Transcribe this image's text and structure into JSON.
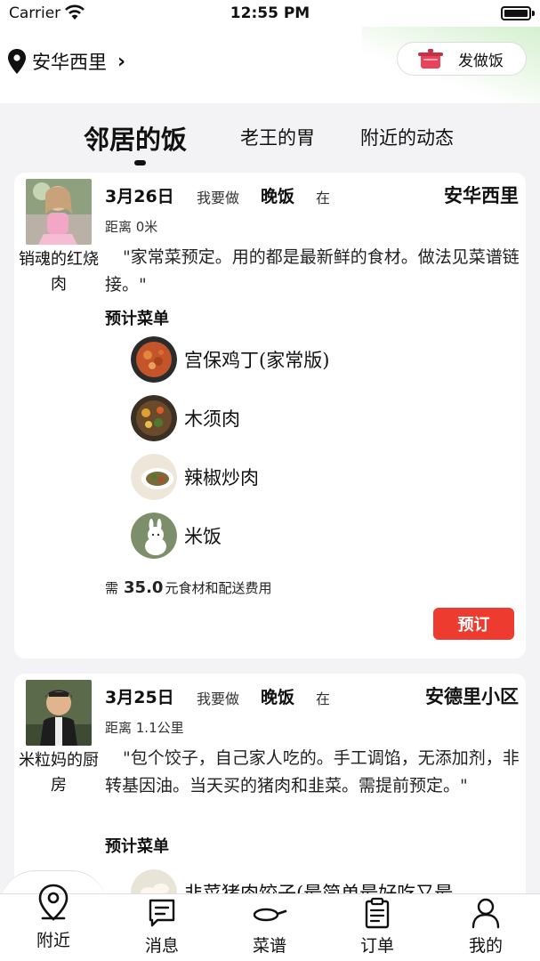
{
  "status_bar": {
    "carrier": "Carrier",
    "time": "12:55 PM"
  },
  "header": {
    "location": "安华西里",
    "cook_button": "发做饭"
  },
  "tabs": [
    {
      "label": "邻居的饭",
      "active": true
    },
    {
      "label": "老王的胃",
      "active": false
    },
    {
      "label": "附近的动态",
      "active": false
    }
  ],
  "posts": [
    {
      "cook_name": "销魂的红烧肉",
      "date": "3月26日",
      "i_want": "我要做",
      "meal": "晚饭",
      "at": "在",
      "place": "安华西里",
      "distance": "距离 0米",
      "description": "\"家常菜预定。用的都是最新鲜的食材。做法见菜谱链接。\"",
      "menu_title": "预计菜单",
      "dishes": [
        "宫保鸡丁(家常版)",
        "木须肉",
        "辣椒炒肉",
        "米饭"
      ],
      "price_prefix": "需",
      "price": "35.0",
      "price_suffix": "元食材和配送费用",
      "order_button": "预订"
    },
    {
      "cook_name": "米粒妈的厨房",
      "date": "3月25日",
      "i_want": "我要做",
      "meal": "晚饭",
      "at": "在",
      "place": "安德里小区",
      "distance": "距离 1.1公里",
      "description": "\"包个饺子，自己家人吃的。手工调馅，无添加剂，非转基因油。当天买的猪肉和韭菜。需提前预定。\"",
      "menu_title": "预计菜单",
      "dishes": [
        "韭菜猪肉饺子(最简单最好吃又最"
      ]
    }
  ],
  "tab_bar": [
    {
      "label": "附近",
      "icon": "location-pin-icon",
      "active": true
    },
    {
      "label": "消息",
      "icon": "message-icon"
    },
    {
      "label": "菜谱",
      "icon": "frying-pan-icon"
    },
    {
      "label": "订单",
      "icon": "clipboard-icon"
    },
    {
      "label": "我的",
      "icon": "person-icon"
    }
  ],
  "colors": {
    "accent_red": "#ee3b2f",
    "header_glow": "#d4f0cf"
  }
}
